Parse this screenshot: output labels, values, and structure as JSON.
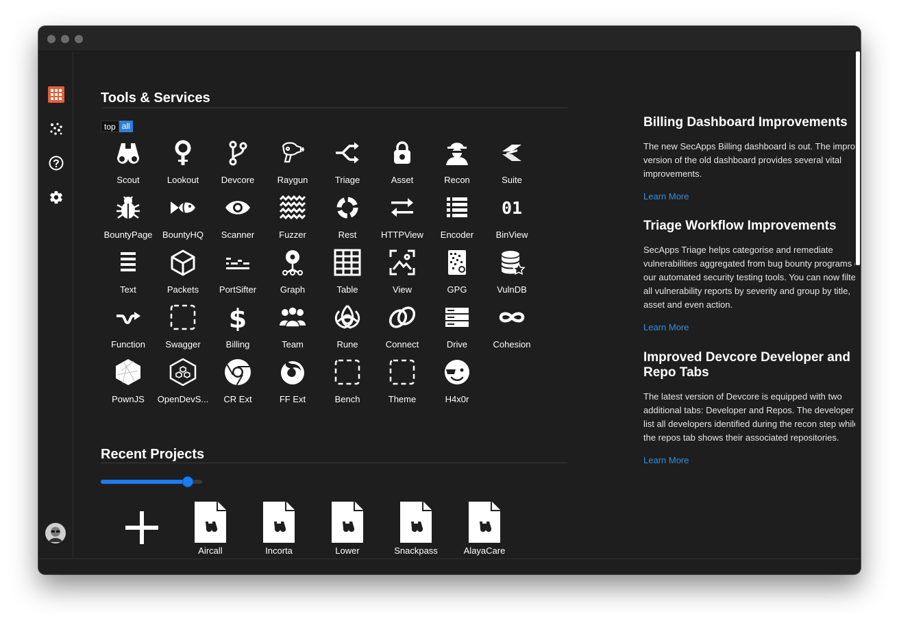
{
  "sidebar": {
    "items": [
      {
        "icon": "apps-grid-icon",
        "accent": "#e2613b"
      },
      {
        "icon": "network-dots-icon"
      },
      {
        "icon": "help-circle-icon"
      },
      {
        "icon": "gear-icon"
      }
    ],
    "avatar": "user-avatar",
    "expand": "chevron-right-icon"
  },
  "tools_section": {
    "title": "Tools & Services",
    "filter": {
      "top": "top",
      "all": "all",
      "selected": "all"
    },
    "tools": [
      {
        "label": "Scout",
        "icon": "binoculars-icon"
      },
      {
        "label": "Lookout",
        "icon": "lookout-icon"
      },
      {
        "label": "Devcore",
        "icon": "git-branch-icon"
      },
      {
        "label": "Raygun",
        "icon": "raygun-icon"
      },
      {
        "label": "Triage",
        "icon": "triage-arrows-icon"
      },
      {
        "label": "Asset",
        "icon": "lock-gear-icon"
      },
      {
        "label": "Recon",
        "icon": "spy-icon"
      },
      {
        "label": "Suite",
        "icon": "suite-logo-icon"
      },
      {
        "label": "BountyPage",
        "icon": "bug-icon"
      },
      {
        "label": "BountyHQ",
        "icon": "fish-icon"
      },
      {
        "label": "Scanner",
        "icon": "eye-icon"
      },
      {
        "label": "Fuzzer",
        "icon": "waves-icon"
      },
      {
        "label": "Rest",
        "icon": "ring-icon"
      },
      {
        "label": "HTTPView",
        "icon": "exchange-arrows-icon"
      },
      {
        "label": "Encoder",
        "icon": "list-icon"
      },
      {
        "label": "BinView",
        "icon": "binary-icon",
        "glyph": "01"
      },
      {
        "label": "Text",
        "icon": "text-lines-icon"
      },
      {
        "label": "Packets",
        "icon": "cube-icon"
      },
      {
        "label": "PortSifter",
        "icon": "sifter-icon"
      },
      {
        "label": "Graph",
        "icon": "graph-nodes-icon"
      },
      {
        "label": "Table",
        "icon": "table-icon"
      },
      {
        "label": "View",
        "icon": "image-view-icon"
      },
      {
        "label": "GPG",
        "icon": "gpg-key-icon"
      },
      {
        "label": "VulnDB",
        "icon": "database-star-icon"
      },
      {
        "label": "Function",
        "icon": "function-arrow-icon"
      },
      {
        "label": "Swagger",
        "icon": "dashed-square-icon"
      },
      {
        "label": "Billing",
        "icon": "dollar-icon"
      },
      {
        "label": "Team",
        "icon": "team-icon"
      },
      {
        "label": "Rune",
        "icon": "triquetra-icon"
      },
      {
        "label": "Connect",
        "icon": "linked-rings-icon"
      },
      {
        "label": "Drive",
        "icon": "server-icon"
      },
      {
        "label": "Cohesion",
        "icon": "infinity-icon"
      },
      {
        "label": "PownJS",
        "icon": "hexagon-gem-icon"
      },
      {
        "label": "OpenDevS...",
        "icon": "hexagon-cubes-icon"
      },
      {
        "label": "CR Ext",
        "icon": "chrome-icon"
      },
      {
        "label": "FF Ext",
        "icon": "firefox-icon"
      },
      {
        "label": "Bench",
        "icon": "dashed-square-icon"
      },
      {
        "label": "Theme",
        "icon": "dashed-square-icon"
      },
      {
        "label": "H4x0r",
        "icon": "hacker-face-icon"
      }
    ]
  },
  "projects_section": {
    "title": "Recent Projects",
    "zoom_fraction": 0.9,
    "new_project_icon": "plus-icon",
    "projects": [
      {
        "label": "Aircall"
      },
      {
        "label": "Incorta"
      },
      {
        "label": "Lower"
      },
      {
        "label": "Snackpass"
      },
      {
        "label": "AlayaCare"
      }
    ],
    "more_projects_visible": 6
  },
  "news": [
    {
      "title": "Billing Dashboard Improvements",
      "body": "The new SecApps Billing dashboard is out. The improved version of the old dashboard provides several vital improvements.",
      "link": "Learn More"
    },
    {
      "title": "Triage Workflow Improvements",
      "body": "SecApps Triage helps categorise and remediate vulnerabilities aggregated from bug bounty programs or our automated security testing tools. You can now filter all vulnerability reports by severity and group by title, asset and even action.",
      "link": "Learn More"
    },
    {
      "title": "Improved Devcore Developer and Repo Tabs",
      "body": "The latest version of Devcore is equipped with two additional tabs: Developer and Repos. The developer tab list all developers identified during the recon step while the repos tab shows their associated repositories.",
      "link": "Learn More"
    }
  ],
  "colors": {
    "background": "#1e1e1e",
    "accent": "#2d7fd8",
    "link": "#2f8fe0",
    "brand": "#e2613b"
  }
}
